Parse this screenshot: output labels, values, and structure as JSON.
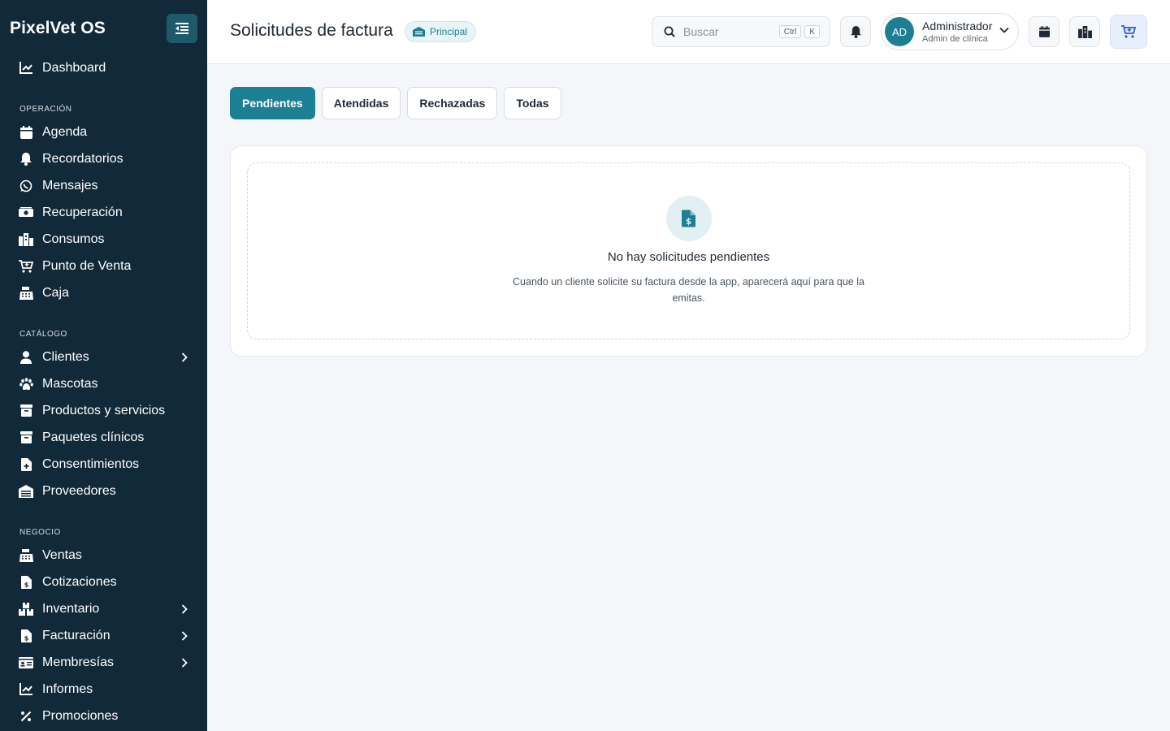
{
  "app": {
    "brand": "PixelVet OS"
  },
  "sidebar": {
    "top_item": {
      "label": "Dashboard",
      "icon": "chart-line-icon"
    },
    "sections": [
      {
        "title": "OPERACIÓN",
        "items": [
          {
            "label": "Agenda",
            "icon": "calendar-icon"
          },
          {
            "label": "Recordatorios",
            "icon": "bell-icon"
          },
          {
            "label": "Mensajes",
            "icon": "whatsapp-icon"
          },
          {
            "label": "Recuperación",
            "icon": "money-bill-icon"
          },
          {
            "label": "Consumos",
            "icon": "warehouse-icon"
          },
          {
            "label": "Punto de Venta",
            "icon": "cart-plus-icon"
          },
          {
            "label": "Caja",
            "icon": "cash-register-icon"
          }
        ]
      },
      {
        "title": "CATÁLOGO",
        "items": [
          {
            "label": "Clientes",
            "icon": "user-icon",
            "expandable": true
          },
          {
            "label": "Mascotas",
            "icon": "paw-icon"
          },
          {
            "label": "Productos y servicios",
            "icon": "box-icon"
          },
          {
            "label": "Paquetes clínicos",
            "icon": "briefcase-icon"
          },
          {
            "label": "Consentimientos",
            "icon": "file-medical-icon"
          },
          {
            "label": "Proveedores",
            "icon": "building-icon"
          }
        ]
      },
      {
        "title": "NEGOCIO",
        "items": [
          {
            "label": "Ventas",
            "icon": "cash-register-icon"
          },
          {
            "label": "Cotizaciones",
            "icon": "file-invoice-dollar-icon"
          },
          {
            "label": "Inventario",
            "icon": "boxes-icon",
            "expandable": true
          },
          {
            "label": "Facturación",
            "icon": "file-invoice-dollar-icon",
            "expandable": true
          },
          {
            "label": "Membresías",
            "icon": "id-card-icon",
            "expandable": true
          },
          {
            "label": "Informes",
            "icon": "chart-line-icon"
          },
          {
            "label": "Promociones",
            "icon": "percent-icon"
          }
        ]
      }
    ]
  },
  "header": {
    "title": "Solicitudes de factura",
    "branch": "Principal",
    "search": {
      "placeholder": "Buscar",
      "value": "",
      "shortcut": [
        "Ctrl",
        "K"
      ]
    },
    "user": {
      "initials": "AD",
      "name": "Administrador",
      "role": "Admin de clínica"
    }
  },
  "tabs": [
    {
      "label": "Pendientes",
      "active": true
    },
    {
      "label": "Atendidas",
      "active": false
    },
    {
      "label": "Rechazadas",
      "active": false
    },
    {
      "label": "Todas",
      "active": false
    }
  ],
  "empty_state": {
    "icon": "file-invoice-dollar-icon",
    "title": "No hay solicitudes pendientes",
    "text": "Cuando un cliente solicite su factura desde la app, aparecerá aquí para que la emitas."
  },
  "colors": {
    "sidebar_bg": "#12293a",
    "accent": "#1d7f93",
    "cart_accent": "#2f5fd6"
  }
}
